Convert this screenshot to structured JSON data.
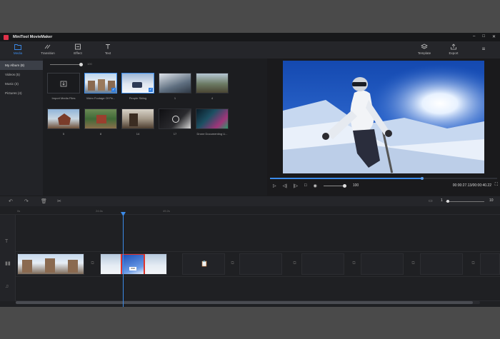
{
  "app": {
    "title": "MiniTool MovieMaker"
  },
  "window_controls": {
    "minimize": "–",
    "maximize": "□",
    "close": "✕"
  },
  "toolbar": {
    "media": "Media",
    "transition": "Transition",
    "effect": "Effect",
    "text": "Text",
    "template": "Template",
    "export": "Export",
    "menu_icon": "≡"
  },
  "leftnav": {
    "items": [
      {
        "label": "My Album (8)",
        "active": true
      },
      {
        "label": "Videos (5)"
      },
      {
        "label": "Music (3)"
      },
      {
        "label": "Pictures (4)"
      }
    ]
  },
  "media": {
    "zoom_value": "100",
    "import_label": "Import Media Files",
    "tiles": [
      {
        "caption": "Video Footage Of Pe...",
        "selected": true
      },
      {
        "caption": "People Skiing",
        "selected": true
      },
      {
        "caption": "1"
      },
      {
        "caption": "4"
      },
      {
        "caption": "5"
      },
      {
        "caption": "8"
      },
      {
        "caption": "14"
      },
      {
        "caption": "17"
      },
      {
        "caption": "Drone Documenting U..."
      }
    ]
  },
  "preview": {
    "timecode": "00:00:27.13/00:00:40.22",
    "volume": "100",
    "progress_fraction": 0.67,
    "volume_fraction": 1.0
  },
  "timeline": {
    "ruler_labels": [
      "0s",
      "24.6s",
      "49.2s"
    ],
    "zoom_min": "1",
    "zoom_max": "10",
    "selected_clip_tag": "Shift"
  },
  "colors": {
    "accent": "#3b8bea",
    "brand": "#e0324a",
    "selection_outline": "#e0342c"
  }
}
